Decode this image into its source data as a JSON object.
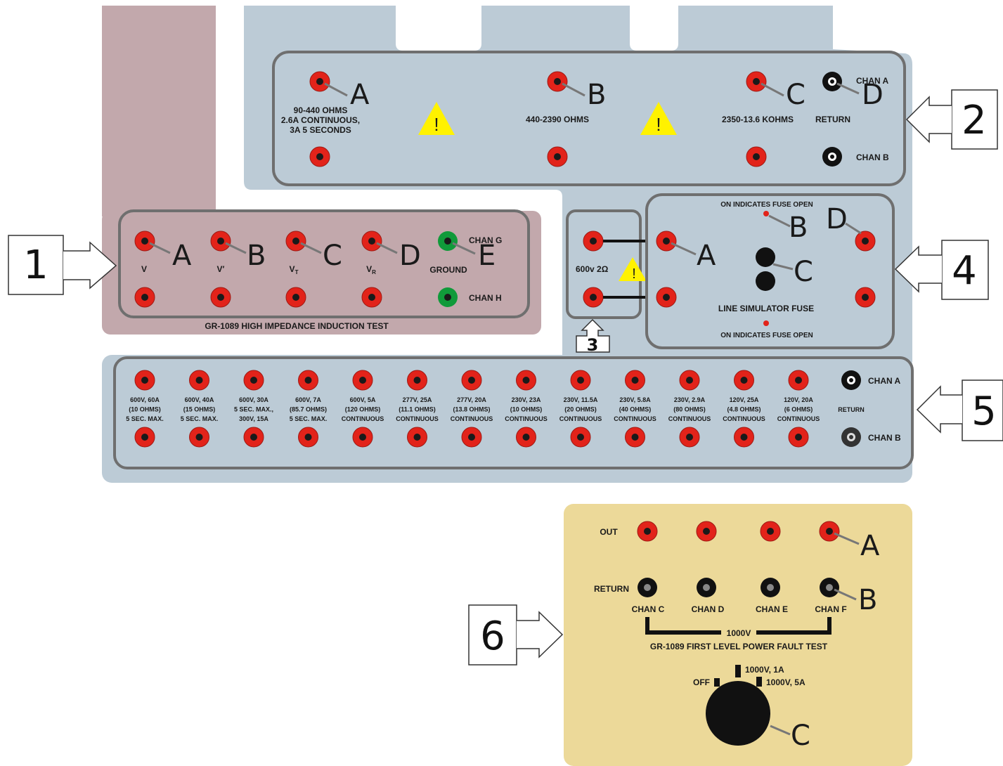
{
  "colors": {
    "blue_panel": "#bccbd6",
    "mauve_panel": "#c2a8ac",
    "yellow_panel": "#ecd999",
    "jack_red": "#e2231a",
    "jack_green": "#109a3a",
    "jack_black": "#111111",
    "warning_yellow": "#fff200",
    "panel_border": "#6f6f6f"
  },
  "callouts": [
    "1",
    "2",
    "3",
    "4",
    "5",
    "6"
  ],
  "panel1": {
    "title": "GR-1089 HIGH IMPEDANCE INDUCTION TEST",
    "probe_letters": [
      "A",
      "B",
      "C",
      "D",
      "E"
    ],
    "jack_labels": [
      "V",
      "V′",
      "V",
      "V",
      "GROUND"
    ],
    "subscripts": [
      "T",
      "R"
    ],
    "chan_g": "CHAN G",
    "chan_h": "CHAN H"
  },
  "panel2": {
    "probe_letters": [
      "A",
      "B",
      "C",
      "D"
    ],
    "a_lines": [
      "90-440 OHMS",
      "2.6A CONTINUOUS,",
      "3A 5 SECONDS"
    ],
    "b_label": "440-2390 OHMS",
    "c_label": "2350-13.6 KOHMS",
    "return_label": "RETURN",
    "chan_a": "CHAN A",
    "chan_b": "CHAN B",
    "warning_glyph": "!"
  },
  "panel3": {
    "label": "600v 2Ω",
    "warning_glyph": "!"
  },
  "panel4": {
    "probe_letters": [
      "A",
      "B",
      "C",
      "D"
    ],
    "top_text": "ON INDICATES FUSE OPEN",
    "bottom_text": "ON INDICATES FUSE OPEN",
    "fuse_label": "LINE SIMULATOR FUSE"
  },
  "panel5": {
    "columns": [
      [
        "600V, 60A",
        "(10 OHMS)",
        "5 SEC. MAX."
      ],
      [
        "600V, 40A",
        "(15 OHMS)",
        "5 SEC. MAX."
      ],
      [
        "600V, 30A",
        "5 SEC. MAX.,",
        "300V, 15A"
      ],
      [
        "600V, 7A",
        "(85.7 OHMS)",
        "5 SEC. MAX."
      ],
      [
        "600V, 5A",
        "(120 OHMS)",
        "CONTINUOUS"
      ],
      [
        "277V, 25A",
        "(11.1 OHMS)",
        "CONTINUOUS"
      ],
      [
        "277V, 20A",
        "(13.8 OHMS)",
        "CONTINUOUS"
      ],
      [
        "230V, 23A",
        "(10 OHMS)",
        "CONTINUOUS"
      ],
      [
        "230V, 11.5A",
        "(20 OHMS)",
        "CONTINUOUS"
      ],
      [
        "230V, 5.8A",
        "(40 OHMS)",
        "CONTINUOUS"
      ],
      [
        "230V, 2.9A",
        "(80 OHMS)",
        "CONTINUOUS"
      ],
      [
        "120V, 25A",
        "(4.8 OHMS)",
        "CONTINUOUS"
      ],
      [
        "120V, 20A",
        "(6 OHMS)",
        "CONTINUOUS"
      ]
    ],
    "chan_a": "CHAN A",
    "return_label": "RETURN",
    "chan_b": "CHAN B"
  },
  "panel6": {
    "probe_letters": [
      "A",
      "B",
      "C"
    ],
    "out_label": "OUT",
    "return_label": "RETURN",
    "channels": [
      "CHAN C",
      "CHAN D",
      "CHAN E",
      "CHAN F"
    ],
    "bus_label": "1000V",
    "title": "GR-1089 FIRST LEVEL POWER FAULT TEST",
    "switch_off": "OFF",
    "switch_1a": "1000V, 1A",
    "switch_5a": "1000V, 5A"
  }
}
